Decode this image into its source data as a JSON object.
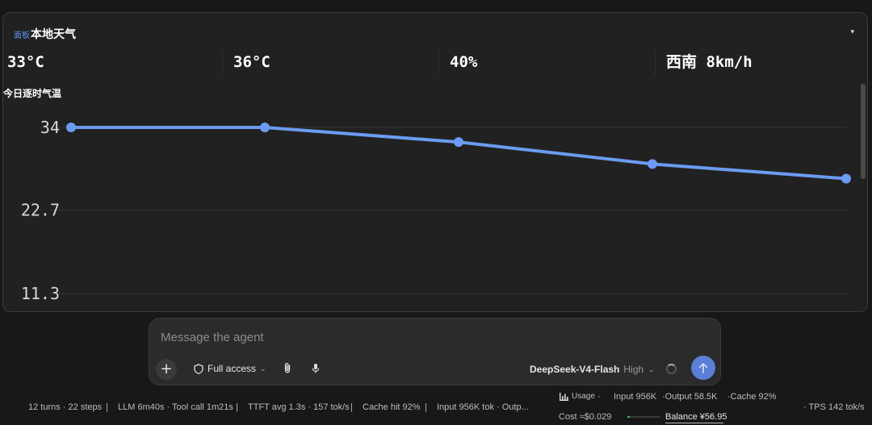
{
  "panel": {
    "tag": "面板",
    "title": "本地天气",
    "caret": "▾",
    "stats": [
      "33°C",
      "36°C",
      "40%",
      "西南 8km/h"
    ]
  },
  "chart_data": {
    "type": "line",
    "title": "今日逐时气温",
    "x": [
      0,
      1,
      2,
      3,
      4
    ],
    "yticks": [
      "34",
      "22.7",
      "11.3"
    ],
    "ytick_values": [
      34,
      22.7,
      11.3
    ],
    "series": [
      {
        "values": [
          34,
          34,
          32,
          29,
          27
        ]
      }
    ],
    "color": "#6b9bf2",
    "grid": true
  },
  "composer": {
    "placeholder": "Message the agent",
    "plus": "+",
    "access_label": "Full access",
    "model_name": "DeepSeek-V4-Flash",
    "model_level": "High"
  },
  "footer": {
    "turns": "12 turns · 22 steps",
    "llm": "LLM 6m40s · Tool call 1m21s",
    "ttft": "TTFT avg 1.3s · 157 tok/s",
    "cache": "Cache hit 92%",
    "input": "Input 956K tok · Outp...",
    "sep": "|",
    "usage_label": "Usage",
    "usage_dot": "·",
    "usage_input": "Input 956K",
    "usage_output": "·Output 58.5K",
    "usage_cache": "·Cache 92%",
    "cost": "Cost ≈$0.029",
    "balance": "Balance ¥56.95",
    "tps": "· TPS 142 tok/s",
    "usage_fraction": 0.08
  },
  "colors": {
    "accent": "#5b7fd6",
    "line": "#6b9bf2",
    "panel": "#212121",
    "bg": "#181818"
  }
}
